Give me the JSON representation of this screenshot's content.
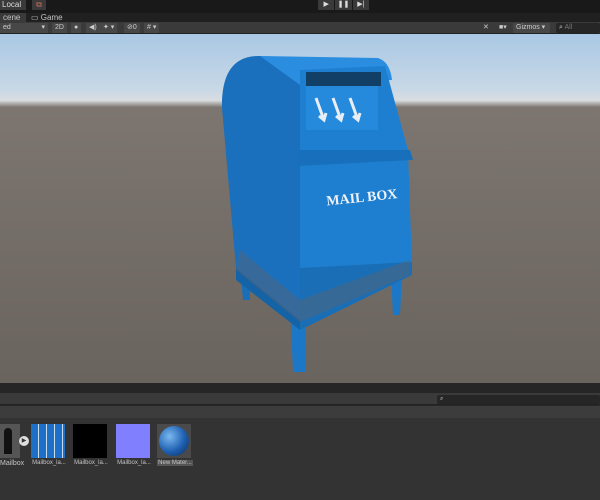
{
  "topbar": {
    "local_label": "Local",
    "layers_icon": "layers-icon",
    "play": [
      "▶",
      "❚❚",
      "▶|"
    ]
  },
  "tabs": [
    {
      "label": "cene",
      "icon": "scene-icon"
    },
    {
      "label": "Game",
      "icon": "game-icon"
    }
  ],
  "toolbar": {
    "shading": "ed",
    "mode_2d": "2D",
    "lighting_icon": "light-bulb-icon",
    "audio_icon": "speaker-icon",
    "effects_icon": "effects-icon",
    "hidden_count": "0",
    "grid_icon": "grid-icon",
    "tools_icon": "tools-icon",
    "camera_icon": "camera-icon",
    "gizmos": "Gizmos",
    "search_placeholder": "All"
  },
  "scene": {
    "model_text": "MAIL BOX",
    "colors": {
      "mailbox": "#1e7fd0",
      "sky": "#a9c8e4",
      "ground": "#6a645e"
    }
  },
  "project": {
    "search_placeholder": "",
    "assets": [
      {
        "label": "Mailbox",
        "type": "model"
      },
      {
        "label": "Mailbox_la...",
        "type": "albedo-texture"
      },
      {
        "label": "Mailbox_la...",
        "type": "black-texture"
      },
      {
        "label": "Mailbox_la...",
        "type": "normal-map"
      },
      {
        "label": "New Mater...",
        "type": "material",
        "selected": true
      }
    ]
  }
}
